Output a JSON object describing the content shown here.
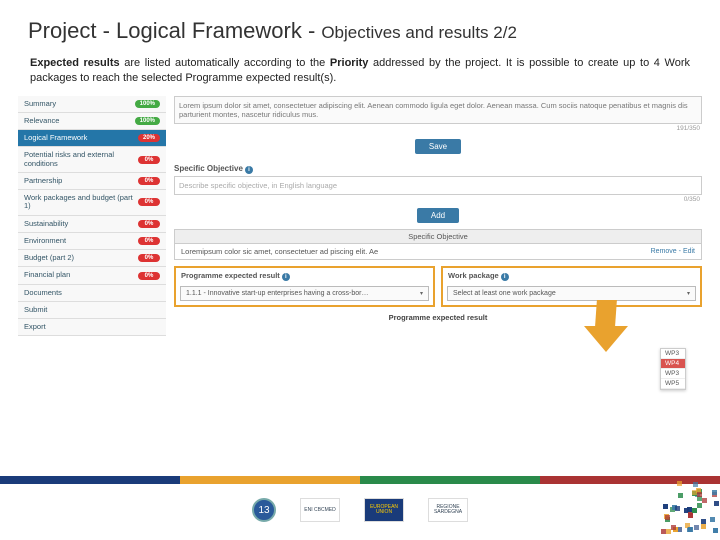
{
  "header": {
    "title_main": "Project - Logical Framework -",
    "title_sub": "Objectives and results 2/2"
  },
  "intro": {
    "bold1": "Expected results",
    "text1": " are listed automatically according to the ",
    "bold2": "Priority",
    "text2": " addressed by the project. It is possible to create up to 4 Work packages to reach the selected Programme expected result(s)."
  },
  "sidebar": {
    "items": [
      {
        "label": "Summary",
        "pill": "100%",
        "cls": "p-green"
      },
      {
        "label": "Relevance",
        "pill": "100%",
        "cls": "p-green"
      },
      {
        "label": "Logical Framework",
        "pill": "20%",
        "cls": "p-red",
        "active": true
      },
      {
        "label": "Potential risks and external conditions",
        "pill": "0%",
        "cls": "p-red"
      },
      {
        "label": "Partnership",
        "pill": "0%",
        "cls": "p-red"
      },
      {
        "label": "Work packages and budget (part 1)",
        "pill": "0%",
        "cls": "p-red"
      },
      {
        "label": "Sustainability",
        "pill": "0%",
        "cls": "p-red"
      },
      {
        "label": "Environment",
        "pill": "0%",
        "cls": "p-red"
      },
      {
        "label": "Budget (part 2)",
        "pill": "0%",
        "cls": "p-red"
      },
      {
        "label": "Financial plan",
        "pill": "0%",
        "cls": "p-red"
      },
      {
        "label": "Documents",
        "pill": "",
        "cls": "p-gray"
      },
      {
        "label": "Submit",
        "pill": "",
        "cls": "p-gray"
      },
      {
        "label": "Export",
        "pill": "",
        "cls": "p-gray"
      }
    ]
  },
  "main": {
    "lorem": "Lorem ipsum dolor sit amet, consectetuer adipiscing elit. Aenean commodo ligula eget dolor. Aenean massa. Cum sociis natoque penatibus et magnis dis parturient montes, nascetur ridiculus mus.",
    "counter1": "191/350",
    "save": "Save",
    "spec_obj_title": "Specific Objective",
    "spec_obj_placeholder": "Describe specific objective, in English language",
    "counter2": "0/350",
    "add": "Add",
    "panel_title": "Specific Objective",
    "panel_text": "Loremipsum color sic amet, consectetuer ad piscing elit. Ae",
    "remove": "Remove",
    "edit": "Edit",
    "prog_result_title": "Programme expected result",
    "prog_result_value": "1.1.1 - Innovative start-up enterprises having a cross-bor…",
    "wp_title": "Work package",
    "wp_placeholder": "Select at least one work package",
    "wp_options": [
      "WP3",
      "WP4",
      "WP3",
      "WP5"
    ],
    "bottom_title": "Programme expected result"
  },
  "footer": {
    "page": "13",
    "logos": [
      "ENI CBCMED",
      "EUROPEAN UNION",
      "REGIONE SARDEGNA"
    ]
  }
}
